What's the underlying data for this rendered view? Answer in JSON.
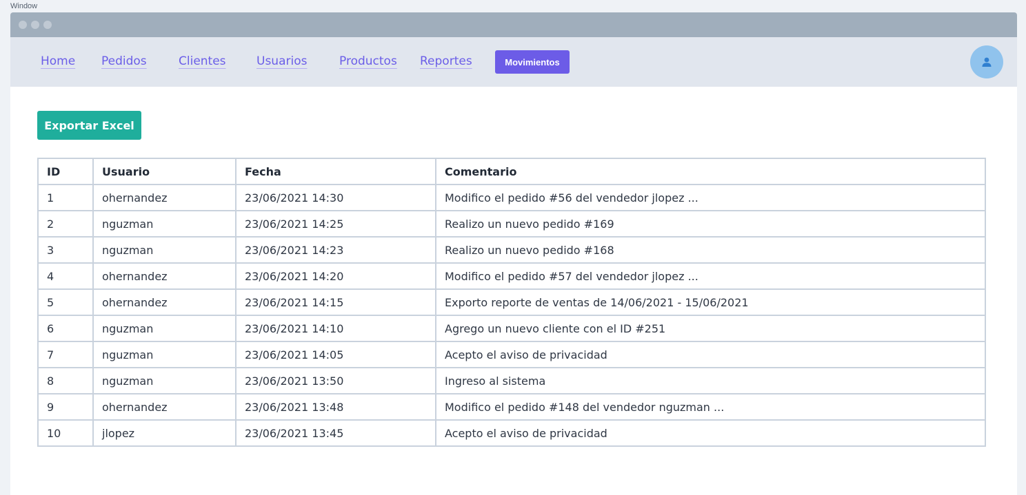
{
  "outer_label": "Window",
  "nav": {
    "links": [
      "Home",
      "Pedidos",
      "Clientes",
      "Usuarios",
      "Productos",
      "Reportes"
    ],
    "active": "Movimientos"
  },
  "user_icon": "user-icon",
  "toolbar": {
    "export_label": "Exportar Excel"
  },
  "table": {
    "columns": [
      "ID",
      "Usuario",
      "Fecha",
      "Comentario"
    ],
    "rows": [
      [
        "1",
        "ohernandez",
        "23/06/2021 14:30",
        "Modifico el pedido #56 del vendedor jlopez ..."
      ],
      [
        "2",
        "nguzman",
        "23/06/2021 14:25",
        "Realizo un nuevo pedido #169"
      ],
      [
        "3",
        "nguzman",
        "23/06/2021 14:23",
        "Realizo un nuevo pedido #168"
      ],
      [
        "4",
        "ohernandez",
        "23/06/2021 14:20",
        "Modifico el pedido #57 del vendedor jlopez ..."
      ],
      [
        "5",
        "ohernandez",
        "23/06/2021 14:15",
        "Exporto reporte de ventas de 14/06/2021 - 15/06/2021"
      ],
      [
        "6",
        "nguzman",
        "23/06/2021 14:10",
        "Agrego un nuevo cliente con el ID #251"
      ],
      [
        "7",
        "nguzman",
        "23/06/2021 14:05",
        "Acepto el aviso de privacidad"
      ],
      [
        "8",
        "nguzman",
        "23/06/2021 13:50",
        "Ingreso al sistema"
      ],
      [
        "9",
        "ohernandez",
        "23/06/2021 13:48",
        "Modifico el pedido #148 del vendedor nguzman ..."
      ],
      [
        "10",
        "jlopez",
        "23/06/2021 13:45",
        "Acepto el aviso de privacidad"
      ]
    ]
  },
  "colors": {
    "accent": "#6c5ce7",
    "nav_link": "#6b5ee8",
    "export_button": "#1fae9c",
    "avatar": "#90c3ed",
    "titlebar": "#a0aebc",
    "navbar": "#e1e6ee"
  }
}
